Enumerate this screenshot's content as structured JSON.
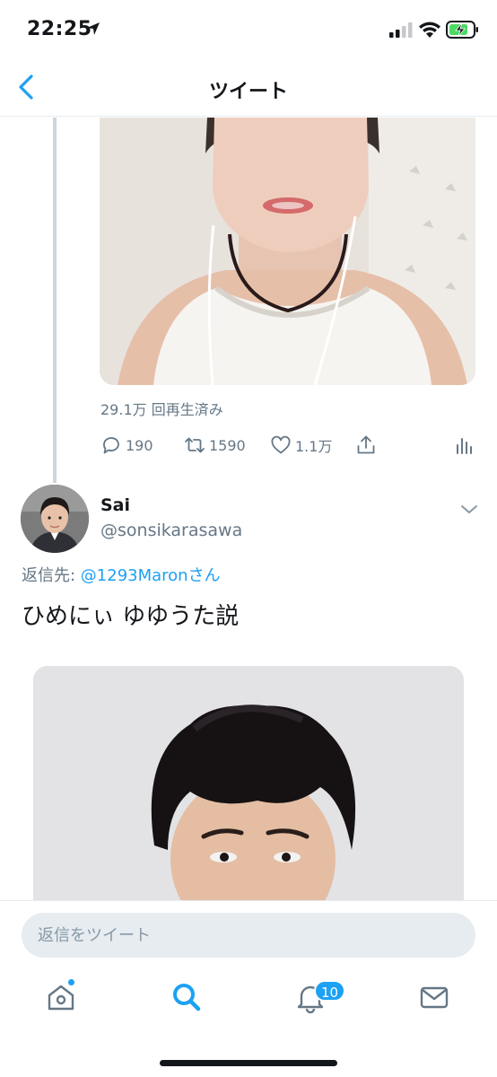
{
  "status_bar": {
    "time": "22:25"
  },
  "nav": {
    "title": "ツイート"
  },
  "first_tweet": {
    "view_count": "29.1万 回再生済み",
    "actions": {
      "replies": "190",
      "retweets": "1590",
      "likes": "1.1万"
    }
  },
  "second_tweet": {
    "author_name": "Sai",
    "author_handle": "@sonsikarasawa",
    "reply_prefix": "返信先: ",
    "reply_mention": "@1293Maronさん",
    "text": "ひめにぃ ゆゆうた説"
  },
  "composer": {
    "placeholder": "返信をツイート"
  },
  "tab_bar": {
    "notifications_badge": "10"
  },
  "colors": {
    "accent": "#1da1f2",
    "secondary_text": "#657786",
    "primary_text": "#14171a",
    "divider": "#e6ecf0",
    "thread_line": "#ccd6dd"
  },
  "icons": [
    "location-arrow-icon",
    "signal-icon",
    "wifi-icon",
    "battery-charging-icon",
    "back-chevron-icon",
    "reply-icon",
    "retweet-icon",
    "like-icon",
    "share-icon",
    "analytics-icon",
    "dropdown-caret-icon",
    "home-icon",
    "search-icon",
    "notifications-icon",
    "messages-icon"
  ]
}
